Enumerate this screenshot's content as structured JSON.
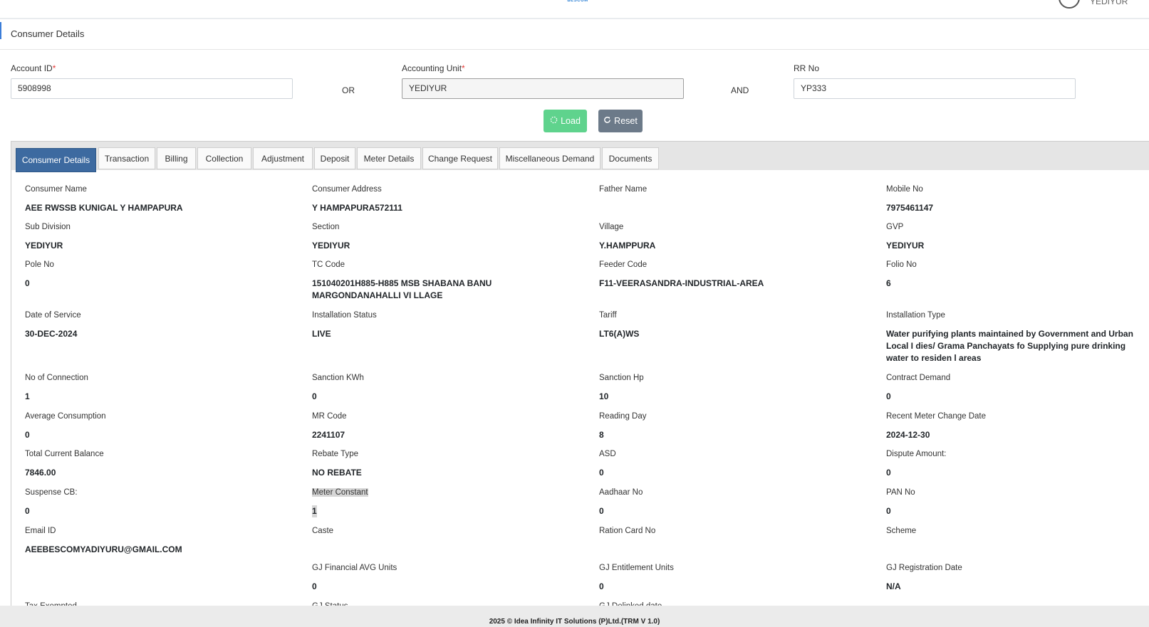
{
  "header": {
    "logo_text": "BESCOM",
    "username": "YEDIYUR"
  },
  "page": {
    "title": "Consumer Details"
  },
  "search": {
    "account_id_label": "Account ID",
    "account_id_value": "5908998",
    "or_label": "OR",
    "accounting_unit_label": "Accounting Unit",
    "accounting_unit_value": "YEDIYUR",
    "and_label": "AND",
    "rr_no_label": "RR No",
    "rr_no_value": "YP333",
    "required_marker": "*",
    "load_label": "Load",
    "reset_label": "Reset"
  },
  "tabs": [
    "Consumer Details",
    "Transaction",
    "Billing",
    "Collection",
    "Adjustment",
    "Deposit",
    "Meter Details",
    "Change Request",
    "Miscellaneous Demand",
    "Documents"
  ],
  "fields": [
    {
      "label": "Consumer Name",
      "value": "AEE RWSSB KUNIGAL Y HAMPAPURA"
    },
    {
      "label": "Consumer Address",
      "value": "Y HAMPAPURA572111"
    },
    {
      "label": "Father Name",
      "value": ""
    },
    {
      "label": "Mobile No",
      "value": "7975461147"
    },
    {
      "label": "Sub Division",
      "value": "YEDIYUR"
    },
    {
      "label": "Section",
      "value": "YEDIYUR"
    },
    {
      "label": "Village",
      "value": "Y.HAMPPURA"
    },
    {
      "label": "GVP",
      "value": "YEDIYUR"
    },
    {
      "label": "Pole No",
      "value": "0"
    },
    {
      "label": "TC Code",
      "value": "151040201H885-H885 MSB SHABANA BANU MARGONDANAHALLI VI LLAGE"
    },
    {
      "label": "Feeder Code",
      "value": "F11-VEERASANDRA-INDUSTRIAL-AREA"
    },
    {
      "label": "Folio No",
      "value": "6"
    },
    {
      "label": "Date of Service",
      "value": "30-DEC-2024"
    },
    {
      "label": "Installation Status",
      "value": "LIVE"
    },
    {
      "label": "Tariff",
      "value": "LT6(A)WS"
    },
    {
      "label": "Installation Type",
      "value": "Water purifying plants maintained by Government and Urban Local I dies/ Grama Panchayats fo Supplying pure drinking water to residen l areas"
    },
    {
      "label": "No of Connection",
      "value": "1"
    },
    {
      "label": "Sanction KWh",
      "value": "0"
    },
    {
      "label": "Sanction Hp",
      "value": "10"
    },
    {
      "label": "Contract Demand",
      "value": "0"
    },
    {
      "label": "Average Consumption",
      "value": "0"
    },
    {
      "label": "MR Code",
      "value": "2241107"
    },
    {
      "label": "Reading Day",
      "value": "8"
    },
    {
      "label": "Recent Meter Change Date",
      "value": "2024-12-30"
    },
    {
      "label": "Total Current Balance",
      "value": "7846.00"
    },
    {
      "label": "Rebate Type",
      "value": "NO REBATE"
    },
    {
      "label": "ASD",
      "value": "0"
    },
    {
      "label": "Dispute Amount:",
      "value": "0"
    },
    {
      "label": "Suspense CB:",
      "value": "0"
    },
    {
      "label": "Meter Constant",
      "value": "1"
    },
    {
      "label": "Aadhaar No",
      "value": "0"
    },
    {
      "label": "PAN No",
      "value": "0"
    },
    {
      "label": "Email ID",
      "value": "AEEBESCOMYADIYURU@GMAIL.COM"
    },
    {
      "label": "Caste",
      "value": ""
    },
    {
      "label": "Ration Card No",
      "value": ""
    },
    {
      "label": "Scheme",
      "value": ""
    },
    {
      "label": "",
      "value": ""
    },
    {
      "label": "GJ Financial AVG Units",
      "value": "0"
    },
    {
      "label": "GJ Entitlement Units",
      "value": "0"
    },
    {
      "label": "GJ Registration Date",
      "value": "N/A"
    },
    {
      "label": "Tax Exempted",
      "value": ""
    },
    {
      "label": "GJ Status",
      "value": ""
    },
    {
      "label": "GJ Delinked date",
      "value": ""
    }
  ],
  "footer": {
    "text": "2025 © Idea Infinity IT Solutions (P)Ltd.(TRM V 1.0)"
  }
}
